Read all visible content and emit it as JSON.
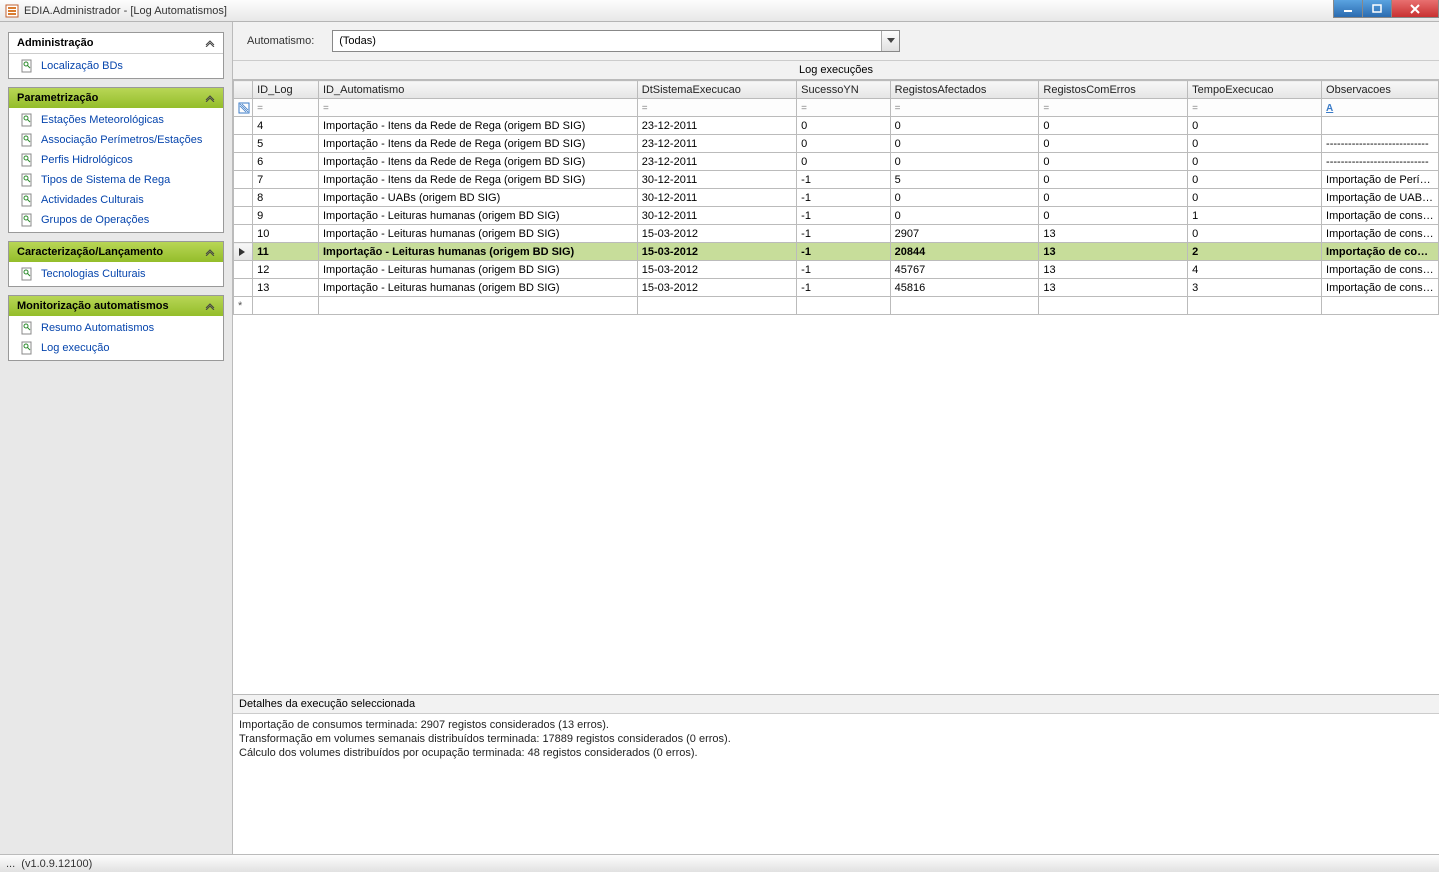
{
  "window": {
    "title": "EDIA.Administrador - [Log Automatismos]"
  },
  "sidebar": {
    "groups": [
      {
        "title": "Administração",
        "style": "white",
        "items": [
          {
            "label": "Localização BDs"
          }
        ]
      },
      {
        "title": "Parametrização",
        "style": "green",
        "items": [
          {
            "label": "Estações Meteorológicas"
          },
          {
            "label": "Associação Perímetros/Estações"
          },
          {
            "label": "Perfis Hidrológicos"
          },
          {
            "label": "Tipos de Sistema de Rega"
          },
          {
            "label": "Actividades Culturais"
          },
          {
            "label": "Grupos de Operações"
          }
        ]
      },
      {
        "title": "Caracterização/Lançamento",
        "style": "green",
        "items": [
          {
            "label": "Tecnologias Culturais"
          }
        ]
      },
      {
        "title": "Monitorização automatismos",
        "style": "green",
        "items": [
          {
            "label": "Resumo Automatismos"
          },
          {
            "label": "Log execução"
          }
        ]
      }
    ]
  },
  "filter": {
    "label": "Automatismo:",
    "value": "(Todas)"
  },
  "grid": {
    "title": "Log execuções",
    "columns": [
      "ID_Log",
      "ID_Automatismo",
      "DtSistemaExecucao",
      "SucessoYN",
      "RegistosAfectados",
      "RegistosComErros",
      "TempoExecucao",
      "Observacoes"
    ],
    "rows": [
      {
        "id": "4",
        "auto": "Importação - Itens da Rede de Rega (origem BD SIG)",
        "dt": "23-12-2011",
        "suc": "0",
        "reg": "0",
        "err": "0",
        "time": "0",
        "obs": ""
      },
      {
        "id": "5",
        "auto": "Importação - Itens da Rede de Rega (origem BD SIG)",
        "dt": "23-12-2011",
        "suc": "0",
        "reg": "0",
        "err": "0",
        "time": "0",
        "obs": "----------------------------"
      },
      {
        "id": "6",
        "auto": "Importação - Itens da Rede de Rega (origem BD SIG)",
        "dt": "23-12-2011",
        "suc": "0",
        "reg": "0",
        "err": "0",
        "time": "0",
        "obs": "----------------------------"
      },
      {
        "id": "7",
        "auto": "Importação - Itens da Rede de Rega (origem BD SIG)",
        "dt": "30-12-2011",
        "suc": "-1",
        "reg": "5",
        "err": "0",
        "time": "0",
        "obs": "Importação de Períme..."
      },
      {
        "id": "8",
        "auto": "Importação - UABs (origem BD SIG)",
        "dt": "30-12-2011",
        "suc": "-1",
        "reg": "0",
        "err": "0",
        "time": "0",
        "obs": "Importação de UABs t..."
      },
      {
        "id": "9",
        "auto": "Importação - Leituras humanas (origem BD SIG)",
        "dt": "30-12-2011",
        "suc": "-1",
        "reg": "0",
        "err": "0",
        "time": "1",
        "obs": "Importação de consu..."
      },
      {
        "id": "10",
        "auto": "Importação - Leituras humanas (origem BD SIG)",
        "dt": "15-03-2012",
        "suc": "-1",
        "reg": "2907",
        "err": "13",
        "time": "0",
        "obs": "Importação de consu..."
      },
      {
        "id": "11",
        "auto": "Importação - Leituras humanas (origem BD SIG)",
        "dt": "15-03-2012",
        "suc": "-1",
        "reg": "20844",
        "err": "13",
        "time": "2",
        "obs": "Importação de consu...",
        "selected": true
      },
      {
        "id": "12",
        "auto": "Importação - Leituras humanas (origem BD SIG)",
        "dt": "15-03-2012",
        "suc": "-1",
        "reg": "45767",
        "err": "13",
        "time": "4",
        "obs": "Importação de consu..."
      },
      {
        "id": "13",
        "auto": "Importação - Leituras humanas (origem BD SIG)",
        "dt": "15-03-2012",
        "suc": "-1",
        "reg": "45816",
        "err": "13",
        "time": "3",
        "obs": "Importação de consu..."
      }
    ]
  },
  "details": {
    "header": "Detalhes da execução seleccionada",
    "line1": "Importação de consumos terminada: 2907 registos considerados (13 erros).",
    "line2": "Transformação em volumes semanais distribuídos terminada: 17889 registos considerados (0 erros).",
    "line3": "Cálculo dos volumes distribuídos por ocupação terminada: 48 registos considerados (0 erros)."
  },
  "statusbar": {
    "prefix": "...",
    "version": "(v1.0.9.12100)"
  }
}
